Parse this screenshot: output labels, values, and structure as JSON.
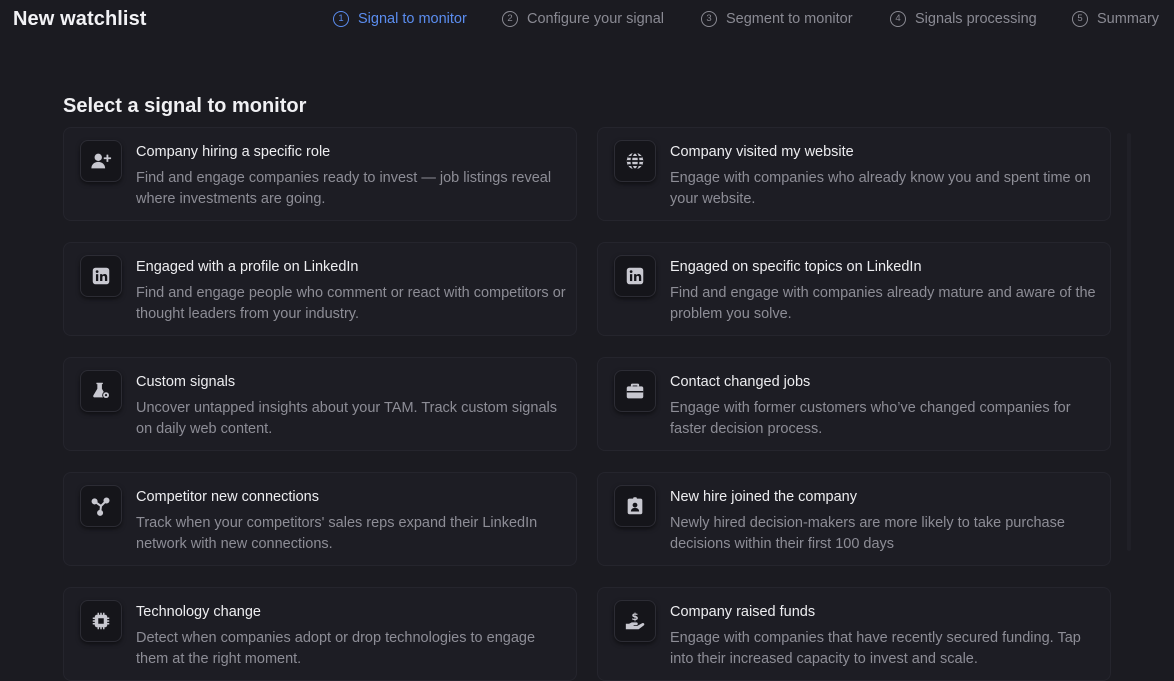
{
  "header": {
    "title": "New watchlist",
    "steps": [
      {
        "num": "1",
        "label": "Signal to monitor"
      },
      {
        "num": "2",
        "label": "Configure your signal"
      },
      {
        "num": "3",
        "label": "Segment to monitor"
      },
      {
        "num": "4",
        "label": "Signals processing"
      },
      {
        "num": "5",
        "label": "Summary"
      }
    ]
  },
  "main": {
    "title": "Select a signal to monitor",
    "cards": [
      {
        "title": "Company hiring a specific role",
        "desc": "Find and engage companies ready to invest — job listings reveal where investments are going.",
        "icon": "person-add-icon"
      },
      {
        "title": "Company visited my website",
        "desc": "Engage with companies who already know you and spent time on your website.",
        "icon": "globe-icon"
      },
      {
        "title": "Engaged with a profile on LinkedIn",
        "desc": "Find and engage people who comment or react with competitors or thought leaders from your industry.",
        "icon": "linkedin-icon"
      },
      {
        "title": "Engaged on specific topics on LinkedIn",
        "desc": "Find and engage with companies already mature and aware of the problem you solve.",
        "icon": "linkedin-icon"
      },
      {
        "title": "Custom signals",
        "desc": "Uncover untapped insights about your TAM. Track custom signals on daily web content.",
        "icon": "flask-gear-icon"
      },
      {
        "title": "Contact changed jobs",
        "desc": "Engage with former customers who’ve changed companies for faster decision process.",
        "icon": "briefcase-icon"
      },
      {
        "title": "Competitor new connections",
        "desc": "Track when your competitors' sales reps expand their LinkedIn network with new connections.",
        "icon": "network-icon"
      },
      {
        "title": "New hire joined the company",
        "desc": "Newly hired decision-makers are more likely to take purchase decisions within their first 100 days",
        "icon": "id-badge-icon"
      },
      {
        "title": "Technology change",
        "desc": "Detect when companies adopt or drop technologies to engage them at the right moment.",
        "icon": "chip-icon"
      },
      {
        "title": "Company raised funds",
        "desc": "Engage with companies that have recently secured funding. Tap into their increased capacity to invest and scale.",
        "icon": "hand-dollar-icon"
      }
    ]
  },
  "colors": {
    "background": "#1b1b21",
    "accent": "#5b8def",
    "muted": "#8a8a93"
  }
}
